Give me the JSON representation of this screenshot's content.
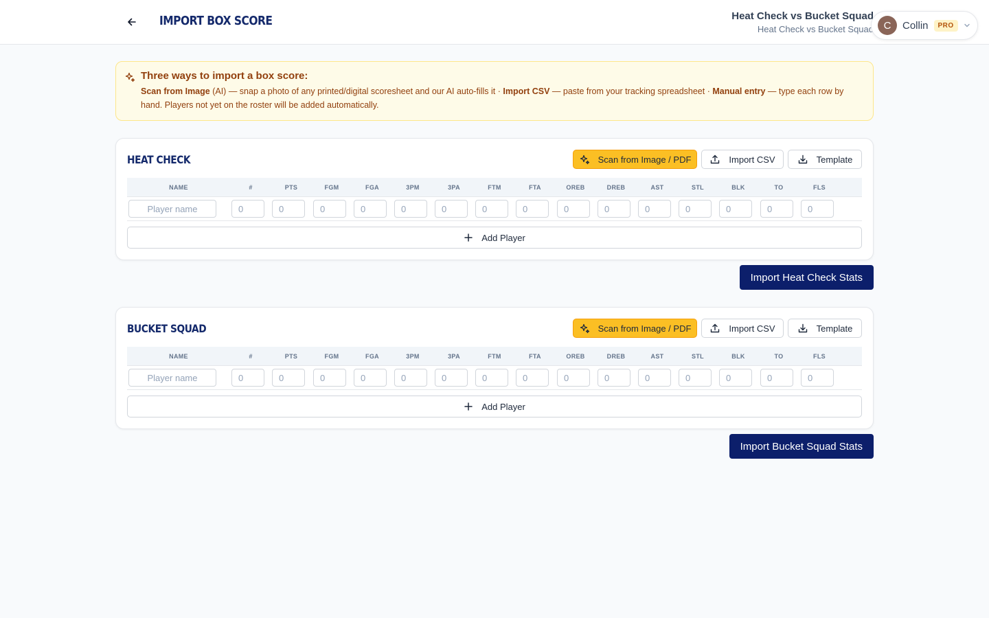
{
  "header": {
    "title": "IMPORT BOX SCORE",
    "game_title": "Heat Check vs Bucket Squad",
    "game_subtitle": "Heat Check vs Bucket Squad",
    "user_initial": "C",
    "user_name": "Collin",
    "badge": "PRO"
  },
  "banner": {
    "title": "Three ways to import a box score:",
    "scan_label": "Scan from Image",
    "scan_desc": " (AI) — snap a photo of any printed/digital scoresheet and our AI auto-fills it · ",
    "csv_label": "Import CSV",
    "csv_desc": " — paste from your tracking spreadsheet · ",
    "manual_label": "Manual entry",
    "manual_desc": " — type each row by hand. Players not yet on the roster will be added automatically."
  },
  "columns": [
    "NAME",
    "#",
    "PTS",
    "FGM",
    "FGA",
    "3PM",
    "3PA",
    "FTM",
    "FTA",
    "OREB",
    "DREB",
    "AST",
    "STL",
    "BLK",
    "TO",
    "FLS"
  ],
  "row_placeholders": {
    "name": "Player name",
    "stat": "0"
  },
  "teams": [
    {
      "name": "HEAT CHECK",
      "scan_label": "Scan from Image / PDF",
      "csv_label": "Import CSV",
      "template_label": "Template",
      "add_label": "Add Player",
      "import_label": "Import Heat Check Stats"
    },
    {
      "name": "BUCKET SQUAD",
      "scan_label": "Scan from Image / PDF",
      "csv_label": "Import CSV",
      "template_label": "Template",
      "add_label": "Add Player",
      "import_label": "Import Bucket Squad Stats"
    }
  ],
  "colors": {
    "brand_navy": "#0c1f6b",
    "accent_amber": "#fbbf24",
    "banner_bg": "#fefbe8"
  }
}
